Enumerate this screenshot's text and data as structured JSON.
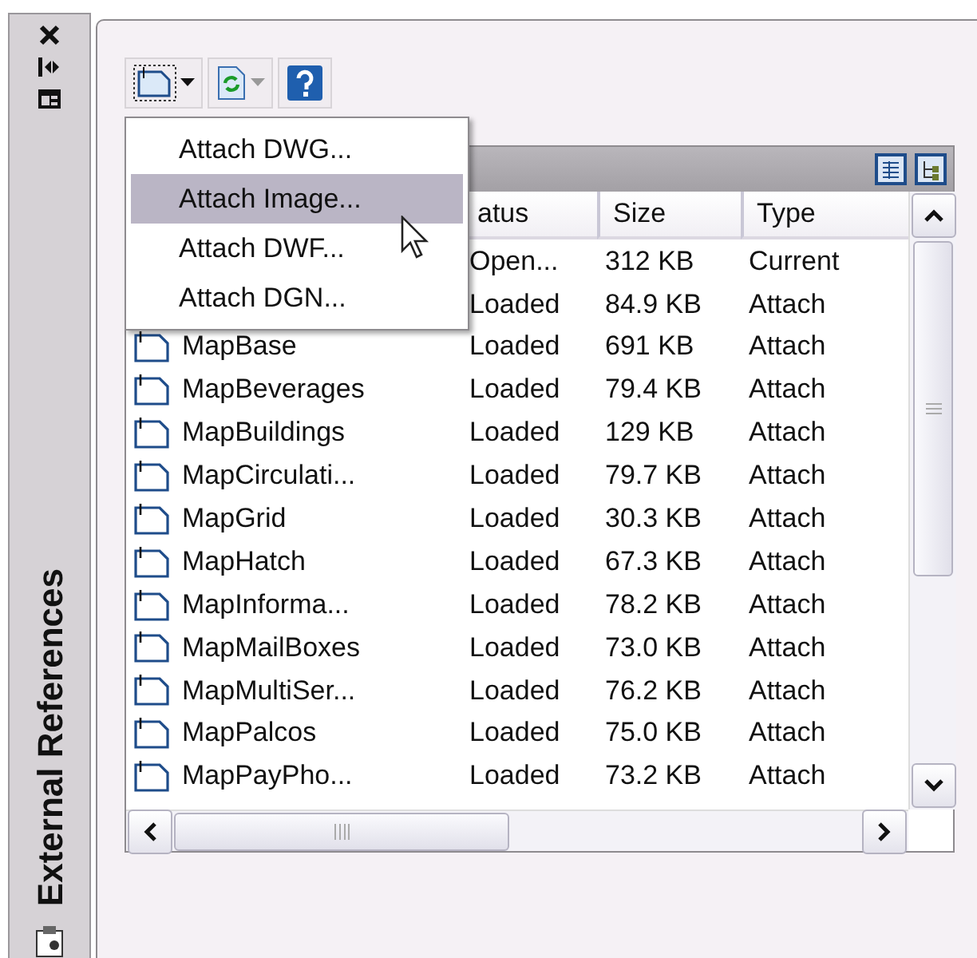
{
  "sidebar": {
    "title": "External References"
  },
  "menu": {
    "items": [
      {
        "label": "Attach DWG...",
        "selected": false
      },
      {
        "label": "Attach Image...",
        "selected": true
      },
      {
        "label": "Attach DWF...",
        "selected": false
      },
      {
        "label": "Attach DGN...",
        "selected": false
      }
    ]
  },
  "grid": {
    "columns": [
      "atus",
      "Size",
      "Type"
    ],
    "rows": [
      {
        "status": "Open...",
        "size": "312 KB",
        "type": "Current"
      },
      {
        "status": "Loaded",
        "size": "84.9 KB",
        "type": "Attach"
      },
      {
        "name": "MapBase",
        "status": "Loaded",
        "size": "691 KB",
        "type": "Attach"
      },
      {
        "name": "MapBeverages",
        "status": "Loaded",
        "size": "79.4 KB",
        "type": "Attach"
      },
      {
        "name": "MapBuildings",
        "status": "Loaded",
        "size": "129 KB",
        "type": "Attach"
      },
      {
        "name": "MapCirculati...",
        "status": "Loaded",
        "size": "79.7 KB",
        "type": "Attach"
      },
      {
        "name": "MapGrid",
        "status": "Loaded",
        "size": "30.3 KB",
        "type": "Attach"
      },
      {
        "name": "MapHatch",
        "status": "Loaded",
        "size": "67.3 KB",
        "type": "Attach"
      },
      {
        "name": "MapInforma...",
        "status": "Loaded",
        "size": "78.2 KB",
        "type": "Attach"
      },
      {
        "name": "MapMailBoxes",
        "status": "Loaded",
        "size": "73.0 KB",
        "type": "Attach"
      },
      {
        "name": "MapMultiSer...",
        "status": "Loaded",
        "size": "76.2 KB",
        "type": "Attach"
      },
      {
        "name": "MapPalcos",
        "status": "Loaded",
        "size": "75.0 KB",
        "type": "Attach"
      },
      {
        "name": "MapPayPho...",
        "status": "Loaded",
        "size": "73.2 KB",
        "type": "Attach"
      }
    ]
  }
}
